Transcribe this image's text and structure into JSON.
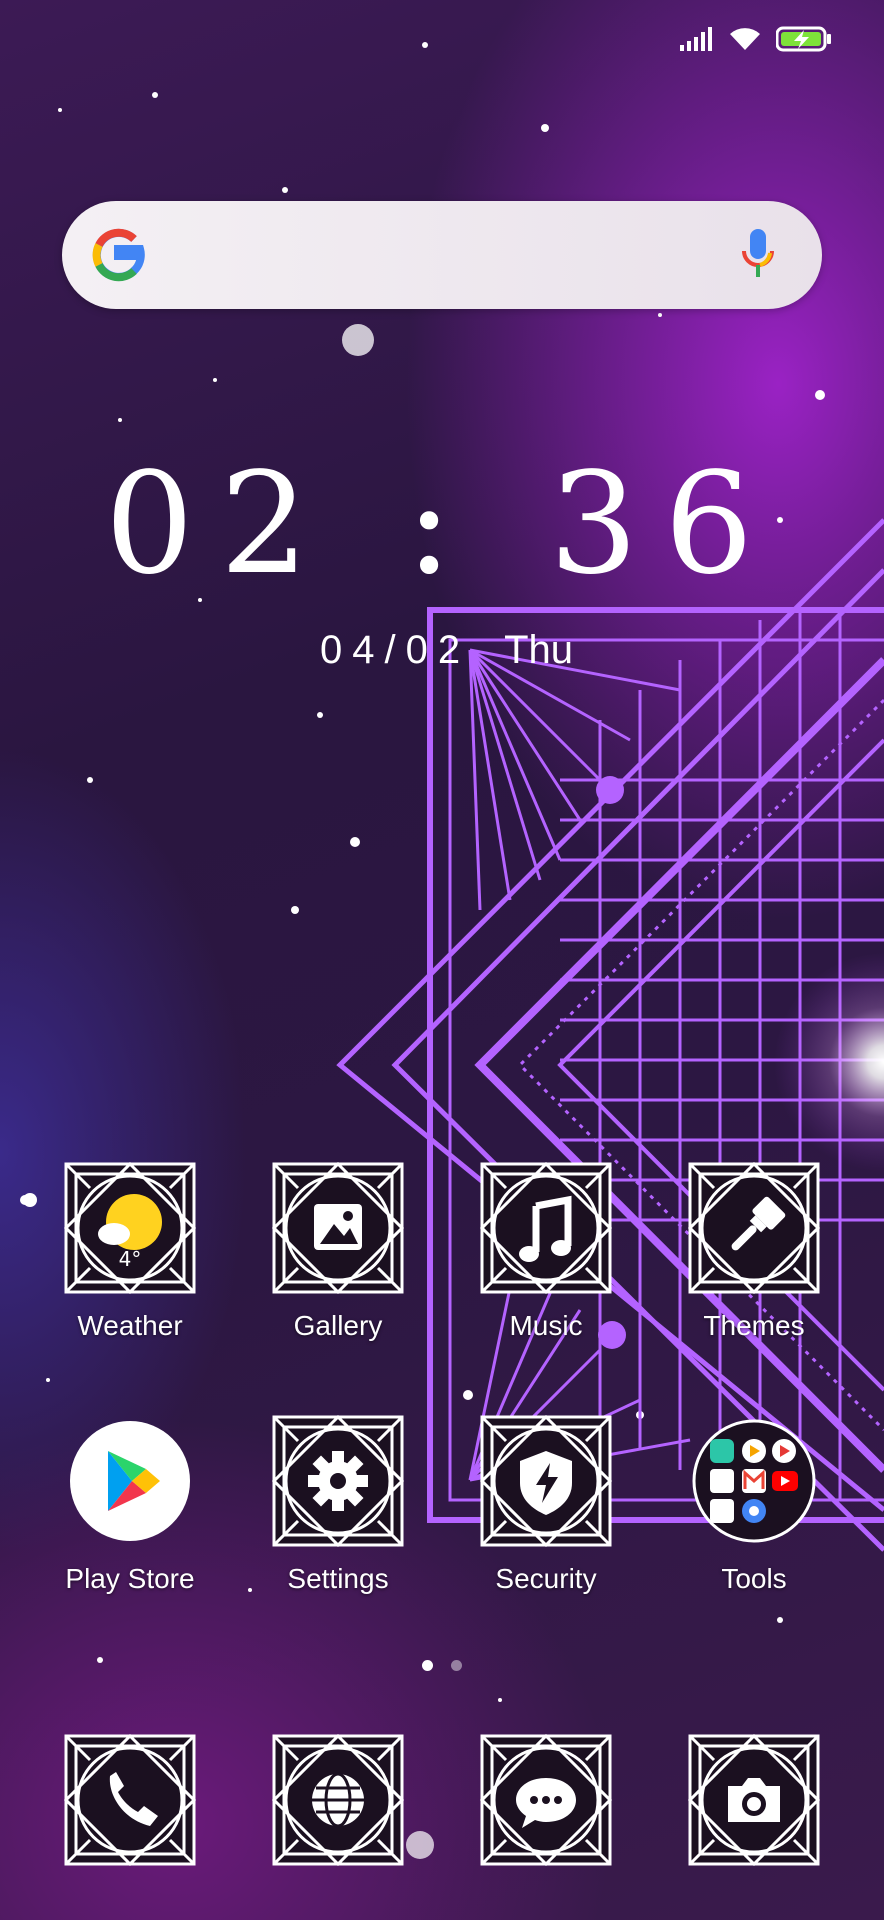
{
  "status_bar": {
    "icons": [
      "signal-icon",
      "wifi-icon",
      "battery-charging-icon"
    ]
  },
  "search_bar": {
    "logo": "google-g-logo",
    "voice_icon": "microphone-icon"
  },
  "clock": {
    "time": "02 : 36",
    "date": "04/02",
    "day": "Thu"
  },
  "apps_row1": [
    {
      "label": "Weather",
      "icon": "weather-sun-cloud-icon",
      "badge": "4°"
    },
    {
      "label": "Gallery",
      "icon": "gallery-image-icon"
    },
    {
      "label": "Music",
      "icon": "music-note-icon"
    },
    {
      "label": "Themes",
      "icon": "paint-brush-icon"
    }
  ],
  "apps_row2": [
    {
      "label": "Play Store",
      "icon": "play-store-icon"
    },
    {
      "label": "Settings",
      "icon": "gear-icon"
    },
    {
      "label": "Security",
      "icon": "shield-bolt-icon"
    },
    {
      "label": "Tools",
      "icon": "folder-icon"
    }
  ],
  "page_indicator": {
    "pages": 2,
    "current": 1
  },
  "dock": [
    {
      "icon": "phone-icon"
    },
    {
      "icon": "browser-globe-icon"
    },
    {
      "icon": "messages-icon"
    },
    {
      "icon": "camera-icon"
    }
  ],
  "colors": {
    "wallpaper_accent": "#b463ff",
    "battery_green": "#7ee23a"
  }
}
